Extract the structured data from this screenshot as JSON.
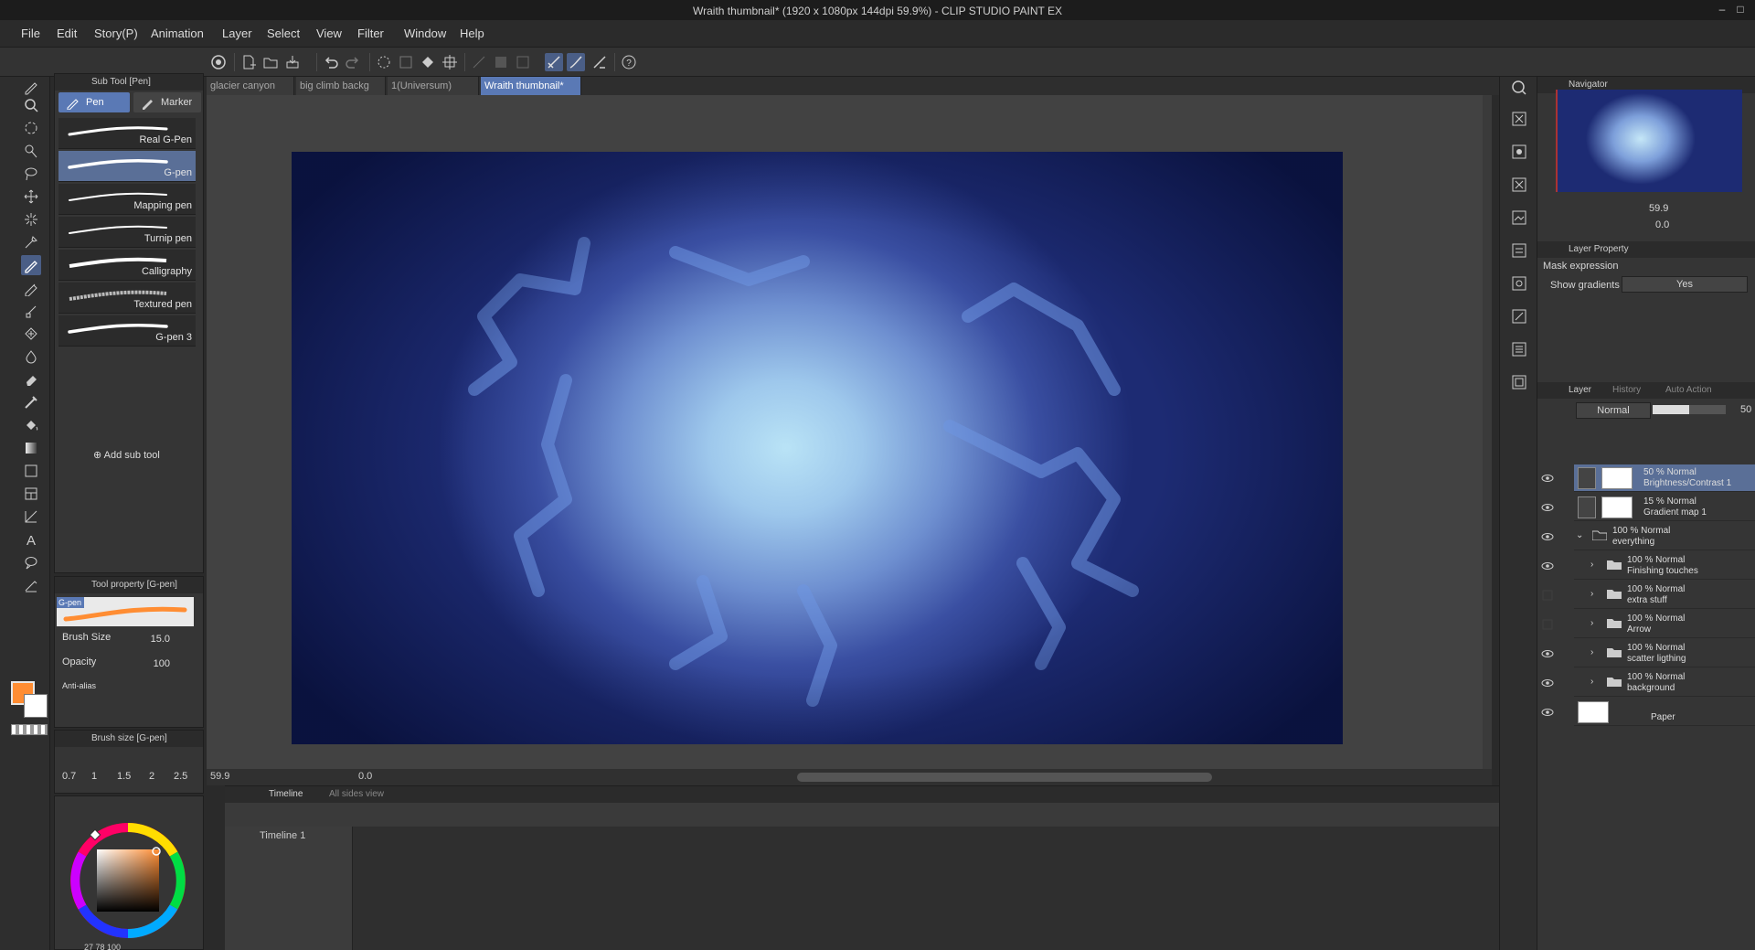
{
  "window": {
    "title": "Wraith thumbnail* (1920 x 1080px 144dpi 59.9%) - CLIP STUDIO PAINT EX"
  },
  "menu": [
    "File",
    "Edit",
    "Story(P)",
    "Animation",
    "Layer",
    "Select",
    "View",
    "Filter",
    "Window",
    "Help"
  ],
  "subtool_panel": {
    "title": "Sub Tool [Pen]",
    "tabs": [
      "Pen",
      "Marker"
    ],
    "brushes": [
      "Real G-Pen",
      "G-pen",
      "Mapping pen",
      "Turnip pen",
      "Calligraphy",
      "Textured pen",
      "G-pen 3"
    ],
    "selected_brush": "G-pen",
    "add_label": "Add sub tool"
  },
  "tool_property": {
    "title": "Tool property [G-pen]",
    "preview_label": "G-pen",
    "brush_size_label": "Brush Size",
    "brush_size": "15.0",
    "opacity_label": "Opacity",
    "opacity": "100",
    "antialias_label": "Anti-alias"
  },
  "brush_size_panel": {
    "title": "Brush size [G-pen]",
    "sizes": [
      "0.7",
      "1",
      "1.5",
      "2",
      "2.5"
    ]
  },
  "color": {
    "main": "#ff8d33",
    "sub": "#ffffff",
    "readout": "27  78  100"
  },
  "doc_tabs": [
    {
      "label": "glacier canyon",
      "active": false
    },
    {
      "label": "big climb backg",
      "active": false
    },
    {
      "label": "1(Universum)",
      "active": false
    },
    {
      "label": "Wraith thumbnail*",
      "active": true
    }
  ],
  "canvas_status": {
    "zoom": "59.9",
    "rotation": "0.0"
  },
  "timeline": {
    "tab": "Timeline",
    "tab2": "All sides view",
    "name": "Timeline 1"
  },
  "navigator": {
    "title": "Navigator",
    "zoom": "59.9",
    "rotation": "0.0"
  },
  "layer_property": {
    "title": "Layer Property",
    "section": "Mask expression",
    "show_gradients_label": "Show gradients",
    "show_gradients_value": "Yes"
  },
  "layer_panel": {
    "tabs": [
      "Layer",
      "History",
      "Auto Action"
    ],
    "blend_mode": "Normal",
    "opacity": "50",
    "layers": [
      {
        "line1": "50 % Normal",
        "line2": "Brightness/Contrast 1",
        "type": "correction",
        "selected": true,
        "visible": true,
        "indent": 0
      },
      {
        "line1": "15 % Normal",
        "line2": "Gradient map 1",
        "type": "correction",
        "selected": false,
        "visible": true,
        "indent": 0
      },
      {
        "line1": "100 % Normal",
        "line2": "everything",
        "type": "folder-open",
        "selected": false,
        "visible": true,
        "indent": 0
      },
      {
        "line1": "100 % Normal",
        "line2": "Finishing touches",
        "type": "folder",
        "selected": false,
        "visible": true,
        "indent": 1
      },
      {
        "line1": "100 % Normal",
        "line2": "extra stuff",
        "type": "folder",
        "selected": false,
        "visible": false,
        "indent": 1
      },
      {
        "line1": "100 % Normal",
        "line2": "Arrow",
        "type": "folder",
        "selected": false,
        "visible": false,
        "indent": 1
      },
      {
        "line1": "100 % Normal",
        "line2": "scatter ligthing",
        "type": "folder",
        "selected": false,
        "visible": true,
        "indent": 1
      },
      {
        "line1": "100 % Normal",
        "line2": "background",
        "type": "folder",
        "selected": false,
        "visible": true,
        "indent": 1
      },
      {
        "line1": "",
        "line2": "Paper",
        "type": "paper",
        "selected": false,
        "visible": true,
        "indent": 0
      }
    ]
  },
  "colors": {
    "accent": "#5a79b5",
    "panel": "#353535",
    "canvas_bg": "#424242"
  }
}
